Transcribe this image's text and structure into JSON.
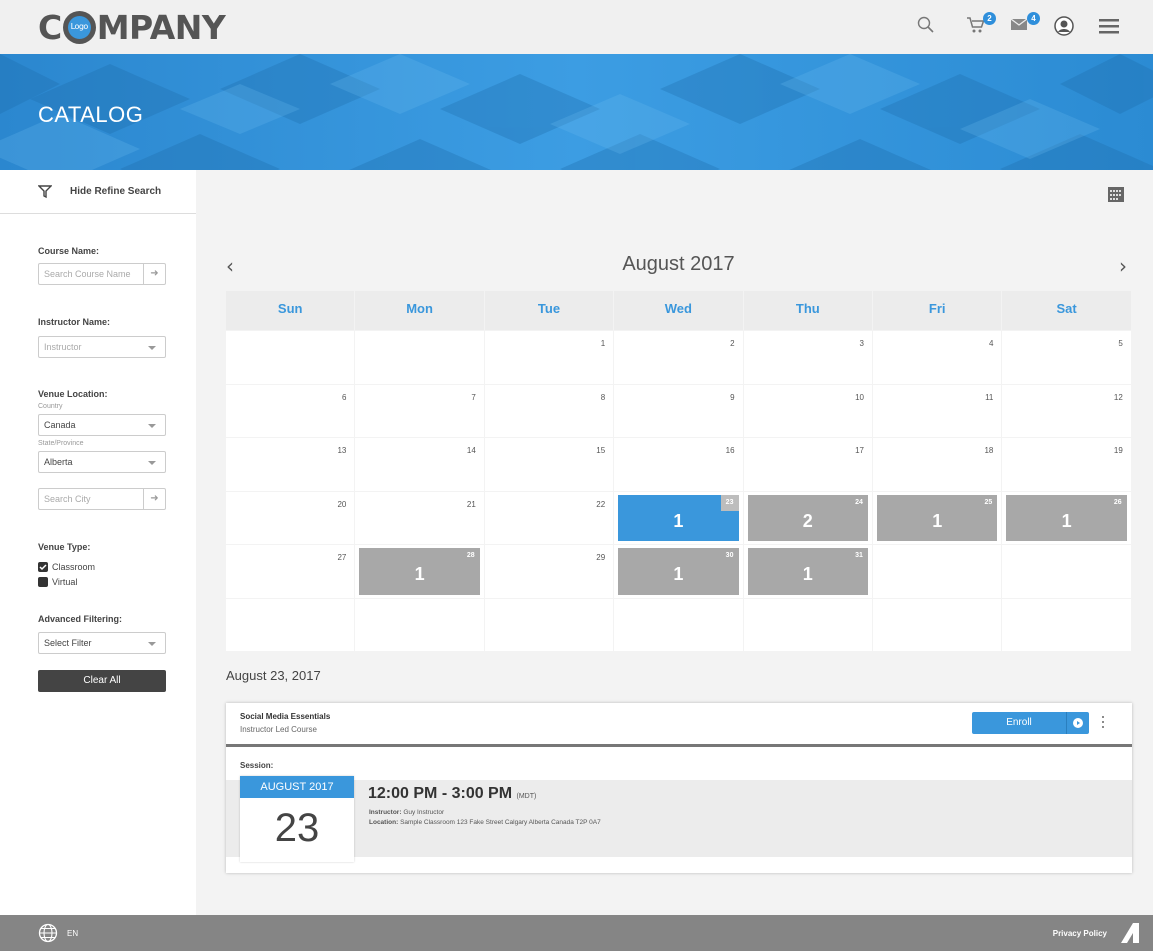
{
  "header": {
    "logo_pre": "C",
    "logo_mark": "Logo",
    "logo_post": "MPANY",
    "cart_count": "2",
    "messages_count": "4"
  },
  "banner": {
    "title": "CATALOG"
  },
  "sidebar": {
    "refine_label": "Hide Refine Search",
    "course_name_label": "Course Name:",
    "course_name_placeholder": "Search Course Name",
    "instructor_label": "Instructor Name:",
    "instructor_placeholder": "Instructor",
    "venue_location_label": "Venue Location:",
    "country_label": "Country",
    "country_value": "Canada",
    "state_label": "State/Province",
    "state_value": "Alberta",
    "city_placeholder": "Search City",
    "venue_type_label": "Venue Type:",
    "classroom_label": "Classroom",
    "virtual_label": "Virtual",
    "advanced_label": "Advanced Filtering:",
    "filter_value": "Select Filter",
    "clear_label": "Clear All"
  },
  "calendar": {
    "title": "August 2017",
    "prev": "‹",
    "next": "›",
    "days_of_week": [
      "Sun",
      "Mon",
      "Tue",
      "Wed",
      "Thu",
      "Fri",
      "Sat"
    ],
    "weeks": [
      [
        "",
        "",
        "1",
        "2",
        "3",
        "4",
        "5"
      ],
      [
        "6",
        "7",
        "8",
        "9",
        "10",
        "11",
        "12"
      ],
      [
        "13",
        "14",
        "15",
        "16",
        "17",
        "18",
        "19"
      ],
      [
        "20",
        "21",
        "22",
        "23",
        "24",
        "25",
        "26"
      ],
      [
        "27",
        "28",
        "29",
        "30",
        "31",
        "",
        ""
      ],
      [
        "",
        "",
        "",
        "",
        "",
        "",
        ""
      ]
    ],
    "events": [
      {
        "date": "23",
        "count": "1",
        "selected": true
      },
      {
        "date": "24",
        "count": "2",
        "selected": false
      },
      {
        "date": "25",
        "count": "1",
        "selected": false
      },
      {
        "date": "26",
        "count": "1",
        "selected": false
      },
      {
        "date": "28",
        "count": "1",
        "selected": false
      },
      {
        "date": "30",
        "count": "1",
        "selected": false
      },
      {
        "date": "31",
        "count": "1",
        "selected": false
      }
    ]
  },
  "selected_date": "August 23, 2017",
  "course": {
    "title": "Social Media Essentials",
    "type": "Instructor Led Course",
    "enroll_label": "Enroll",
    "session_label": "Session:",
    "month": "AUGUST 2017",
    "day": "23",
    "time": "12:00 PM - 3:00 PM",
    "timezone": "(MDT)",
    "instructor_label": "Instructor:",
    "instructor": "Guy Instructor",
    "location_label": "Location:",
    "location": "Sample Classroom 123 Fake Street Calgary Alberta Canada T2P 0A7"
  },
  "footer": {
    "language": "EN",
    "privacy": "Privacy Policy"
  },
  "colors": {
    "accent": "#3a97dc",
    "event_gray": "#a8a8a8",
    "footer": "#858585"
  }
}
